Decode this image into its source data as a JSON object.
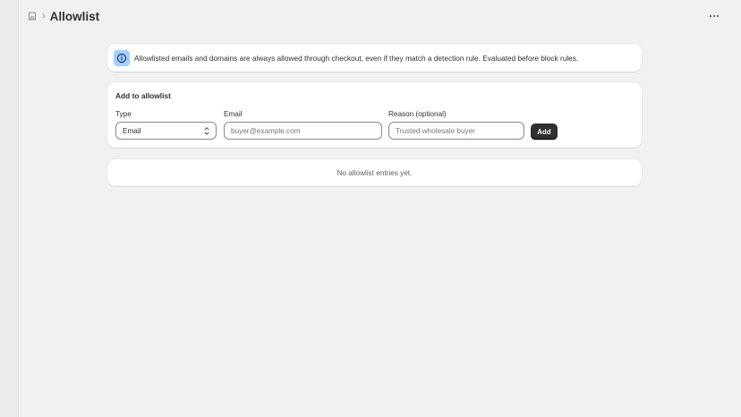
{
  "header": {
    "breadcrumb_icon": "store-icon",
    "title": "Allowlist",
    "more_icon": "ellipsis-icon"
  },
  "banner": {
    "icon": "info-icon",
    "text": "Allowlisted emails and domains are always allowed through checkout, even if they match a detection rule. Evaluated before block rules."
  },
  "add_form": {
    "title": "Add to allowlist",
    "type_label": "Type",
    "type_value": "Email",
    "email_label": "Email",
    "email_placeholder": "buyer@example.com",
    "reason_label": "Reason (optional)",
    "reason_placeholder": "Trusted wholesale buyer",
    "add_button": "Add"
  },
  "list": {
    "empty_text": "No allowlist entries yet."
  },
  "colors": {
    "page_bg": "#f1f1f1",
    "card_bg": "#ffffff",
    "info_badge": "#a4cffa",
    "primary_button": "#303030"
  }
}
